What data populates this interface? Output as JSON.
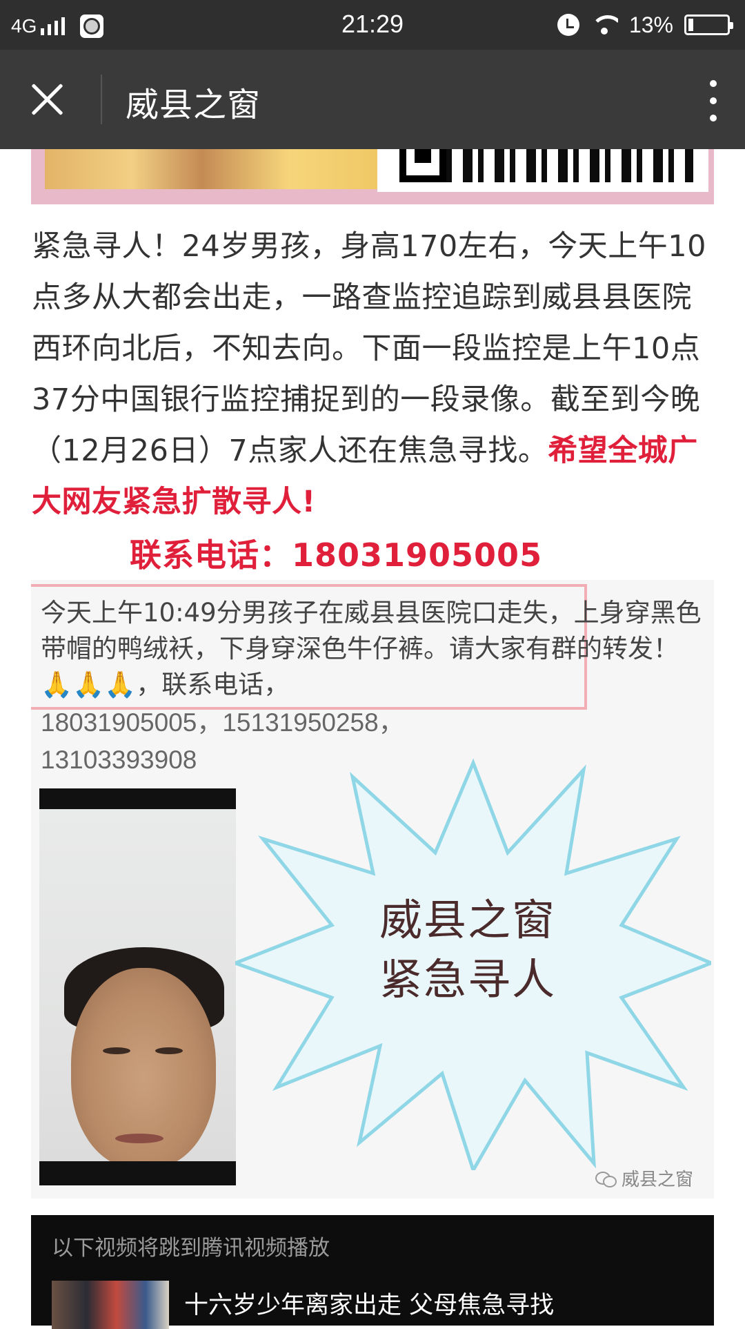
{
  "status_bar": {
    "network": "4G",
    "time": "21:29",
    "battery_percent_text": "13%",
    "battery_level": 0.13,
    "icons": [
      "signal-icon",
      "app-notification-icon",
      "alarm-icon",
      "wifi-icon",
      "battery-icon"
    ]
  },
  "nav": {
    "title": "威县之窗",
    "close_icon": "close-icon",
    "more_icon": "more-vertical-icon"
  },
  "article": {
    "paragraph_plain": "紧急寻人！24岁男孩，身高170左右，今天上午10点多从大都会出走，一路查监控追踪到威县县医院西环向北后，不知去向。下面一段监控是上午10点37分中国银行监控捕捉到的一段录像。截至到今晚（12月26日）7点家人还在焦急寻找。",
    "paragraph_urgent": "希望全城广大网友紧急扩散寻人!",
    "contact_line": "联系电话：18031905005"
  },
  "poster": {
    "notice_text": "今天上午10:49分男孩子在威县县医院口走失，上身穿黑色带帽的鸭绒袄，下身穿深色牛仔裤。请大家有群的转发！🙏🙏🙏，联系电话，",
    "phones_line1": "18031905005，15131950258，",
    "phones_line2": "13103393908",
    "star_line1": "威县之窗",
    "star_line2": "紧急寻人",
    "watermark": "威县之窗",
    "colors": {
      "starburst_fill": "#eaf7fa",
      "starburst_stroke": "#8fd6e6",
      "frame": "#f2aeb4"
    }
  },
  "video": {
    "notice": "以下视频将跳到腾讯视频播放",
    "title": "十六岁少年离家出走 父母焦急寻找"
  }
}
